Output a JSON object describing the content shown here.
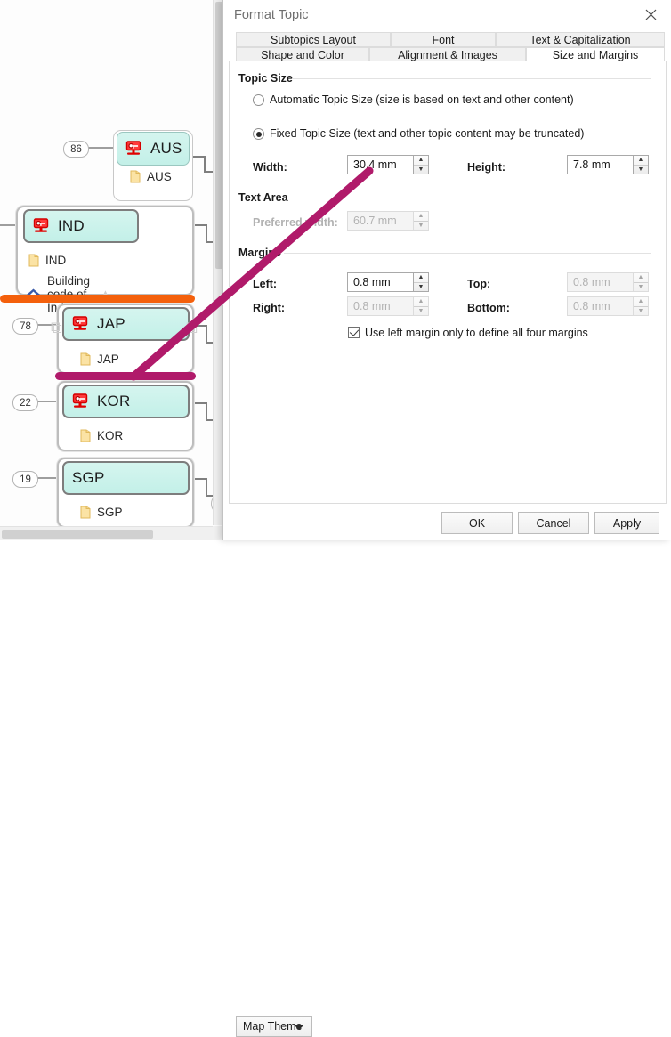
{
  "dialog": {
    "title": "Format Topic",
    "close_icon": "close-icon",
    "tabs_row1": [
      {
        "label": "Subtopics Layout",
        "active": false
      },
      {
        "label": "Font",
        "active": false
      },
      {
        "label": "Text & Capitalization",
        "active": false
      }
    ],
    "tabs_row2": [
      {
        "label": "Shape and Color",
        "active": false
      },
      {
        "label": "Alignment & Images",
        "active": false
      },
      {
        "label": "Size and Margins",
        "active": true
      }
    ],
    "groups": {
      "topic_size": "Topic Size",
      "text_area": "Text Area",
      "margins": "Margins"
    },
    "radios": [
      {
        "label": "Automatic Topic Size (size is based on text and other content)",
        "selected": false
      },
      {
        "label": "Fixed Topic Size (text and other topic content may be truncated)",
        "selected": true
      }
    ],
    "fields": {
      "width_label": "Width:",
      "width_value": "30.4 mm",
      "height_label": "Height:",
      "height_value": "7.8 mm",
      "preferred_width_label": "Preferred width:",
      "preferred_width_value": "60.7 mm",
      "left_label": "Left:",
      "left_value": "0.8 mm",
      "top_label": "Top:",
      "top_value": "0.8 mm",
      "right_label": "Right:",
      "right_value": "0.8 mm",
      "bottom_label": "Bottom:",
      "bottom_value": "0.8 mm"
    },
    "checkbox": {
      "label": "Use left margin only to define all four margins",
      "checked": true
    },
    "footer": {
      "map_theme": "Map Theme",
      "ok": "OK",
      "cancel": "Cancel",
      "apply": "Apply"
    }
  },
  "map": {
    "nodes": [
      {
        "badge": "86",
        "title": "AUS",
        "title_icon": "key-computer-icon",
        "subtopics": [
          {
            "icon": "folder-icon",
            "label": "AUS"
          }
        ]
      },
      {
        "badge": "",
        "title": "IND",
        "title_icon": "key-computer-icon",
        "subtopics": [
          {
            "icon": "folder-icon",
            "label": "IND"
          },
          {
            "icon": "house-icon",
            "label": "Building code of Indian"
          }
        ]
      },
      {
        "badge": "78",
        "title": "JAP",
        "title_icon": "key-computer-icon",
        "subtopics": [
          {
            "icon": "folder-icon",
            "label": "JAP"
          }
        ]
      },
      {
        "badge": "22",
        "title": "KOR",
        "title_icon": "key-computer-icon",
        "subtopics": [
          {
            "icon": "folder-icon",
            "label": "KOR"
          }
        ]
      },
      {
        "badge": "19",
        "title": "SGP",
        "title_icon": "",
        "subtopics": [
          {
            "icon": "folder-icon",
            "label": "SGP"
          }
        ]
      }
    ],
    "collapse_handle": "−"
  },
  "annotations": {
    "highlight_orange": "#f4600c",
    "highlight_magenta": "#b01a6a",
    "topic_fill": "#c9f2ea",
    "topic_border": "#9bc7c0"
  }
}
